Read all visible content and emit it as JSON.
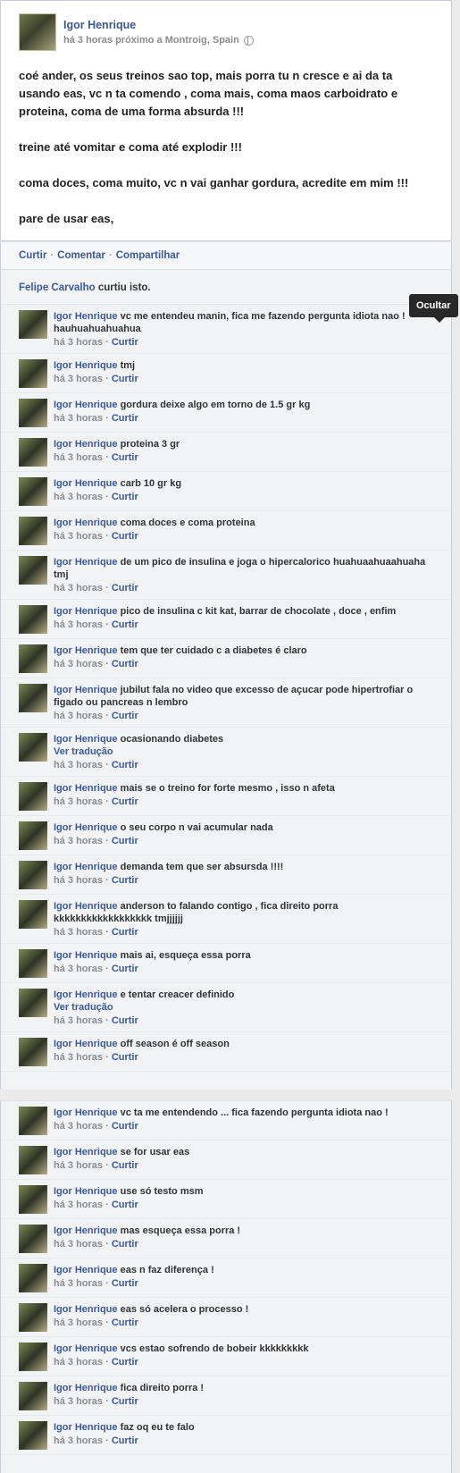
{
  "post": {
    "author": "Igor Henrique",
    "meta": "há 3 horas próximo a Montroig, Spain",
    "paragraphs": [
      "coé ander, os seus treinos sao top, mais porra tu n cresce e ai da ta usando eas, vc n ta comendo , coma mais, coma maos carboidrato e proteina, coma de uma forma absurda !!!",
      "treine até vomitar e coma até explodir !!!",
      "coma doces, coma muito, vc n vai ganhar gordura, acredite em mim !!!",
      "pare de usar eas,"
    ]
  },
  "actions": {
    "like": "Curtir",
    "comment": "Comentar",
    "share": "Compartilhar",
    "dot": "·"
  },
  "likes": {
    "who": "Felipe Carvalho",
    "text": " curtiu isto."
  },
  "tooltip": "Ocultar",
  "comment_time": "há 3 horas",
  "comment_like": "Curtir",
  "translate": "Ver tradução",
  "comments_a": [
    {
      "name": "Igor Henrique",
      "text": "vc me entendeu manin, fica me fazendo pergunta idiota nao ! hauhuahuahuahua"
    },
    {
      "name": "Igor Henrique",
      "text": "tmj"
    },
    {
      "name": "Igor Henrique",
      "text": "gordura deixe algo em torno de 1.5 gr kg"
    },
    {
      "name": "Igor Henrique",
      "text": "proteina 3 gr"
    },
    {
      "name": "Igor Henrique",
      "text": "carb 10 gr kg"
    },
    {
      "name": "Igor Henrique",
      "text": "coma doces e coma proteina"
    },
    {
      "name": "Igor Henrique",
      "text": "de um pico de insulina e joga o hipercalorico huahuaahuaahuaha tmj"
    },
    {
      "name": "Igor Henrique",
      "text": "pico de insulina c kit kat, barrar de chocolate , doce , enfim"
    },
    {
      "name": "Igor Henrique",
      "text": "tem que ter cuidado c a diabetes é claro"
    },
    {
      "name": "Igor Henrique",
      "text": "jubilut fala no video que excesso de açucar pode hipertrofiar o figado ou pancreas n lembro"
    },
    {
      "name": "Igor Henrique",
      "text": "ocasionando diabetes",
      "translate": true
    },
    {
      "name": "Igor Henrique",
      "text": "mais se o treino for forte mesmo , isso n afeta"
    },
    {
      "name": "Igor Henrique",
      "text": "o seu corpo n vai acumular nada"
    },
    {
      "name": "Igor Henrique",
      "text": "demanda tem que ser absursda !!!!"
    },
    {
      "name": "Igor Henrique",
      "text": "anderson to falando contigo , fica direito porra kkkkkkkkkkkkkkkkkk tmjjjjjj"
    },
    {
      "name": "Igor Henrique",
      "text": "mais ai, esqueça essa porra"
    },
    {
      "name": "Igor Henrique",
      "text": "e tentar creacer definido",
      "translate": true
    },
    {
      "name": "Igor Henrique",
      "text": "off season é off season"
    }
  ],
  "comments_b": [
    {
      "name": "Igor Henrique",
      "text": "vc ta me entendendo ... fica fazendo pergunta idiota nao !"
    },
    {
      "name": "Igor Henrique",
      "text": "se for usar eas"
    },
    {
      "name": "Igor Henrique",
      "text": "use só testo msm"
    },
    {
      "name": "Igor Henrique",
      "text": "mas esqueça essa porra !"
    },
    {
      "name": "Igor Henrique",
      "text": "eas n faz diferença !"
    },
    {
      "name": "Igor Henrique",
      "text": "eas só acelera o processo !"
    },
    {
      "name": "Igor Henrique",
      "text": "vcs estao sofrendo de bobeir kkkkkkkkk"
    },
    {
      "name": "Igor Henrique",
      "text": "fica direito porra !"
    },
    {
      "name": "Igor Henrique",
      "text": "faz oq eu te falo"
    }
  ]
}
